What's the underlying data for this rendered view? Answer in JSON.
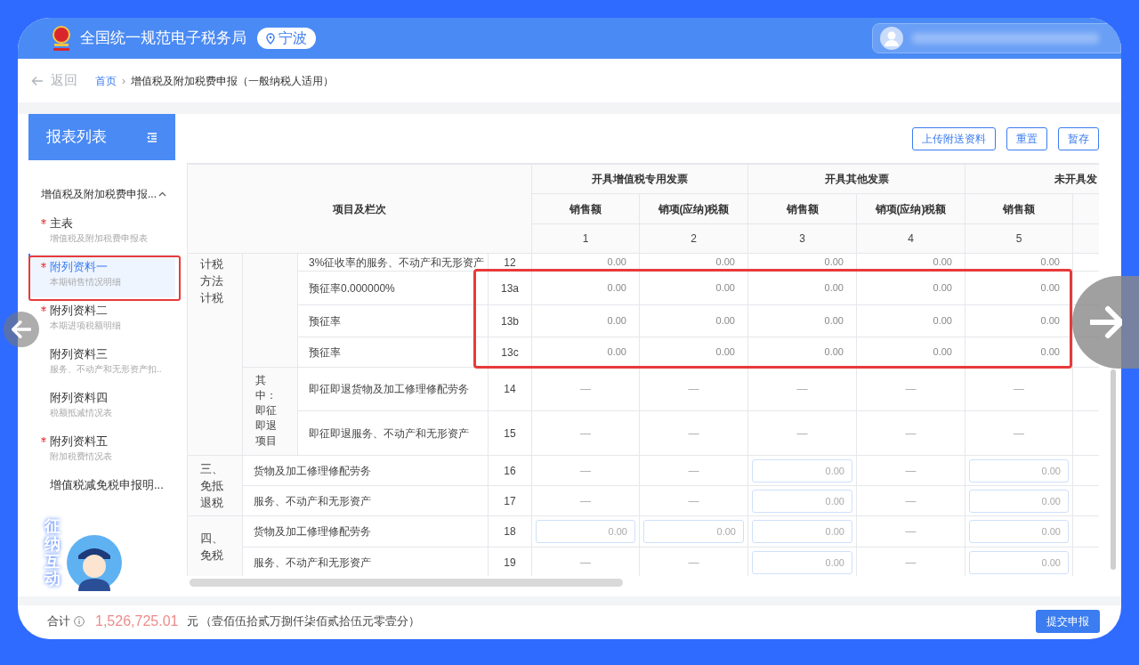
{
  "header": {
    "title": "全国统一规范电子税务局",
    "location": "宁波"
  },
  "breadcrumb": {
    "back": "返回",
    "separator": "›",
    "items": [
      {
        "label": "首页",
        "link": true
      },
      {
        "label": "增值税及附加税费申报（一般纳税人适用）",
        "link": false
      }
    ]
  },
  "sidebar": {
    "title": "报表列表",
    "group": {
      "label": "增值税及附加税费申报...",
      "expanded": true
    },
    "items": [
      {
        "label": "主表",
        "subtitle": "增值税及附加税费申报表",
        "required": true,
        "selected": false
      },
      {
        "label": "附列资料一",
        "subtitle": "本期销售情况明细",
        "required": true,
        "selected": true
      },
      {
        "label": "附列资料二",
        "subtitle": "本期进项税额明细",
        "required": true,
        "selected": false
      },
      {
        "label": "附列资料三",
        "subtitle": "服务、不动产和无形资产扣..",
        "required": false,
        "selected": false
      },
      {
        "label": "附列资料四",
        "subtitle": "税额抵减情况表",
        "required": false,
        "selected": false
      },
      {
        "label": "附列资料五",
        "subtitle": "附加税费情况表",
        "required": true,
        "selected": false
      },
      {
        "label": "增值税减免税申报明...",
        "required": false,
        "selected": false
      }
    ]
  },
  "toolbar": {
    "buttons": [
      "上传附送资料",
      "重置",
      "暂存"
    ]
  },
  "table": {
    "corner": "项目及栏次",
    "groups": [
      {
        "label": "开具增值税专用发票"
      },
      {
        "label": "开具其他发票"
      },
      {
        "label": "未开具发"
      }
    ],
    "subheaders": [
      "销售额",
      "销项(应纳)税额",
      "销售额",
      "销项(应纳)税额",
      "销售额"
    ],
    "numbers": [
      "1",
      "2",
      "3",
      "4",
      "5"
    ],
    "sections": [
      {
        "label": "计税方法计税",
        "groups": [
          {
            "rows": [
              {
                "item": "3%征收率的服务、不动产和无形资产",
                "line": "12",
                "cells": [
                  {
                    "kind": "value",
                    "value": "0.00"
                  },
                  {
                    "kind": "value",
                    "value": "0.00"
                  },
                  {
                    "kind": "value",
                    "value": "0.00"
                  },
                  {
                    "kind": "value",
                    "value": "0.00"
                  },
                  {
                    "kind": "value",
                    "value": "0.00"
                  }
                ]
              },
              {
                "item": "预征率0.000000%",
                "line": "13a",
                "cells": [
                  {
                    "kind": "value",
                    "value": "0.00"
                  },
                  {
                    "kind": "value",
                    "value": "0.00"
                  },
                  {
                    "kind": "value",
                    "value": "0.00"
                  },
                  {
                    "kind": "value",
                    "value": "0.00"
                  },
                  {
                    "kind": "value",
                    "value": "0.00"
                  }
                ]
              },
              {
                "item": "预征率",
                "line": "13b",
                "cells": [
                  {
                    "kind": "value",
                    "value": "0.00"
                  },
                  {
                    "kind": "value",
                    "value": "0.00"
                  },
                  {
                    "kind": "value",
                    "value": "0.00"
                  },
                  {
                    "kind": "value",
                    "value": "0.00"
                  },
                  {
                    "kind": "value",
                    "value": "0.00"
                  }
                ]
              },
              {
                "item": "预征率",
                "line": "13c",
                "cells": [
                  {
                    "kind": "value",
                    "value": "0.00"
                  },
                  {
                    "kind": "value",
                    "value": "0.00"
                  },
                  {
                    "kind": "value",
                    "value": "0.00"
                  },
                  {
                    "kind": "value",
                    "value": "0.00"
                  },
                  {
                    "kind": "value",
                    "value": "0.00"
                  }
                ]
              }
            ]
          },
          {
            "label": "其中：即征即退项目",
            "rows": [
              {
                "item": "即征即退货物及加工修理修配劳务",
                "line": "14",
                "cells": [
                  {
                    "kind": "dash",
                    "value": "—"
                  },
                  {
                    "kind": "dash",
                    "value": "—"
                  },
                  {
                    "kind": "dash",
                    "value": "—"
                  },
                  {
                    "kind": "dash",
                    "value": "—"
                  },
                  {
                    "kind": "dash",
                    "value": "—"
                  }
                ]
              },
              {
                "item": "即征即退服务、不动产和无形资产",
                "line": "15",
                "cells": [
                  {
                    "kind": "dash",
                    "value": "—"
                  },
                  {
                    "kind": "dash",
                    "value": "—"
                  },
                  {
                    "kind": "dash",
                    "value": "—"
                  },
                  {
                    "kind": "dash",
                    "value": "—"
                  },
                  {
                    "kind": "dash",
                    "value": "—"
                  }
                ]
              }
            ]
          }
        ]
      },
      {
        "label": "三、免抵退税",
        "rows": [
          {
            "item": "货物及加工修理修配劳务",
            "line": "16",
            "cells": [
              {
                "kind": "dash",
                "value": "—"
              },
              {
                "kind": "dash",
                "value": "—"
              },
              {
                "kind": "input",
                "value": "0.00"
              },
              {
                "kind": "dash",
                "value": "—"
              },
              {
                "kind": "input",
                "value": "0.00"
              }
            ]
          },
          {
            "item": "服务、不动产和无形资产",
            "line": "17",
            "cells": [
              {
                "kind": "dash",
                "value": "—"
              },
              {
                "kind": "dash",
                "value": "—"
              },
              {
                "kind": "input",
                "value": "0.00"
              },
              {
                "kind": "dash",
                "value": "—"
              },
              {
                "kind": "input",
                "value": "0.00"
              }
            ]
          }
        ]
      },
      {
        "label": "四、免税",
        "rows": [
          {
            "item": "货物及加工修理修配劳务",
            "line": "18",
            "cells": [
              {
                "kind": "input",
                "value": "0.00"
              },
              {
                "kind": "input",
                "value": "0.00"
              },
              {
                "kind": "input",
                "value": "0.00"
              },
              {
                "kind": "dash",
                "value": "—"
              },
              {
                "kind": "input",
                "value": "0.00"
              }
            ]
          },
          {
            "item": "服务、不动产和无形资产",
            "line": "19",
            "cells": [
              {
                "kind": "dash",
                "value": "—"
              },
              {
                "kind": "dash",
                "value": "—"
              },
              {
                "kind": "input",
                "value": "0.00"
              },
              {
                "kind": "dash",
                "value": "—"
              },
              {
                "kind": "input",
                "value": "0.00"
              }
            ]
          }
        ]
      }
    ]
  },
  "footer": {
    "label": "合计",
    "amount": "1,526,725.01",
    "unit": "元",
    "amount_words": "（壹佰伍拾贰万捌仟柒佰贰拾伍元零壹分）",
    "submit": "提交申报"
  },
  "assistant": {
    "label": "征纳互动"
  }
}
